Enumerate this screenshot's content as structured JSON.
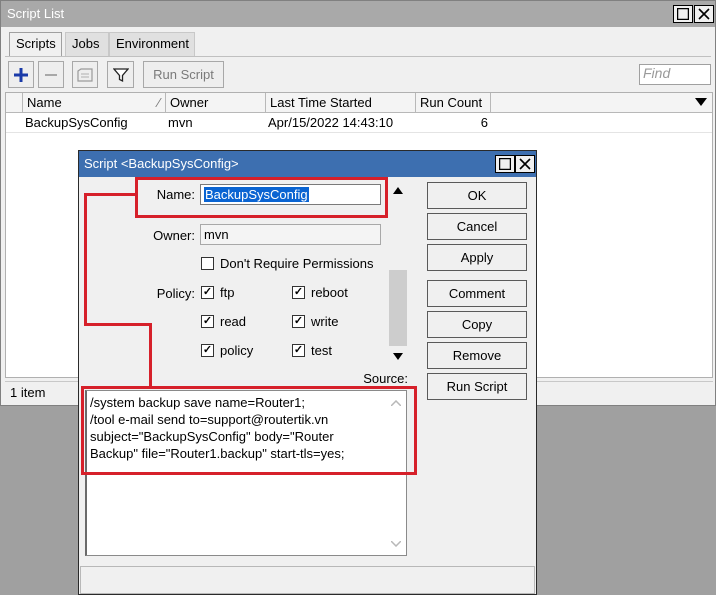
{
  "main_window": {
    "title": "Script List",
    "tabs": [
      "Scripts",
      "Jobs",
      "Environment"
    ],
    "toolbar": {
      "run_script_label": "Run Script",
      "find_placeholder": "Find"
    },
    "columns": [
      "Name",
      "Owner",
      "Last Time Started",
      "Run Count"
    ],
    "rows": [
      {
        "name": "BackupSysConfig",
        "owner": "mvn",
        "last_started": "Apr/15/2022 14:43:10",
        "run_count": "6"
      }
    ],
    "status": "1 item"
  },
  "dialog": {
    "title": "Script <BackupSysConfig>",
    "name_label": "Name:",
    "name_value": "BackupSysConfig",
    "owner_label": "Owner:",
    "owner_value": "mvn",
    "dont_require_perm_label": "Don't Require Permissions",
    "policy_label": "Policy:",
    "policies": [
      {
        "label": "ftp",
        "checked": true
      },
      {
        "label": "reboot",
        "checked": true
      },
      {
        "label": "read",
        "checked": true
      },
      {
        "label": "write",
        "checked": true
      },
      {
        "label": "policy",
        "checked": true
      },
      {
        "label": "test",
        "checked": true
      }
    ],
    "source_label": "Source:",
    "source_text": "/system backup save name=Router1;\n/tool e-mail send to=support@routertik.vn subject=\"BackupSysConfig\" body=\"Router Backup\" file=\"Router1.backup\" start-tls=yes;",
    "buttons": {
      "ok": "OK",
      "cancel": "Cancel",
      "apply": "Apply",
      "comment": "Comment",
      "copy": "Copy",
      "remove": "Remove",
      "run_script": "Run Script"
    }
  },
  "colors": {
    "annotation_red": "#d6202a",
    "dialog_title_bar": "#3d6fb0",
    "main_title_bar": "#a9a9a9",
    "selection_blue": "#0a64d2",
    "add_icon_blue": "#1a3aa8"
  }
}
